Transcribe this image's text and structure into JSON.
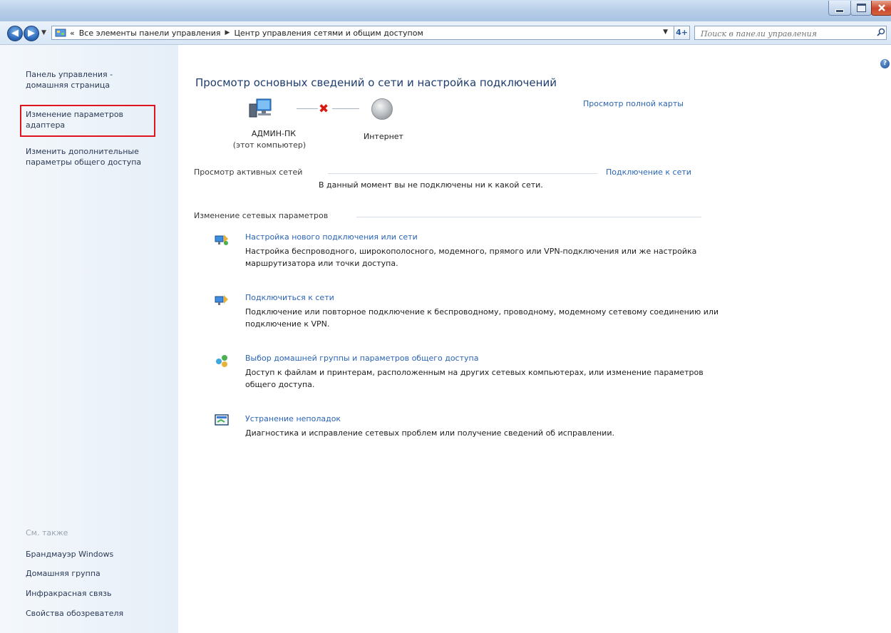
{
  "window": {
    "colors": {
      "title_gradient": "#b6cde8",
      "link": "#2a64b5",
      "highlight_box": "#e0141e",
      "close_button": "#c8462a"
    }
  },
  "address": {
    "overflow": "«",
    "crumbs": [
      "Все элементы панели управления",
      "Центр управления сетями и общим доступом"
    ],
    "search_placeholder": "Поиск в панели управления",
    "refresh_glyph": "4+"
  },
  "icons": {
    "back": "back-arrow-icon",
    "forward": "forward-arrow-icon",
    "control_panel": "control-panel-icon",
    "search": "search-icon",
    "help": "help-icon",
    "computer": "computer-icon",
    "globe": "globe-icon",
    "disconnect": "red-x-icon"
  },
  "sidebar": {
    "home": "Панель управления - домашняя страница",
    "adapter": "Изменение параметров адаптера",
    "sharing": "Изменить дополнительные параметры общего доступа",
    "see_also_label": "См. также",
    "see_also": [
      "Брандмауэр Windows",
      "Домашняя группа",
      "Инфракрасная связь",
      "Свойства обозревателя"
    ]
  },
  "main": {
    "title": "Просмотр основных сведений о сети и настройка подключений",
    "full_map": "Просмотр полной карты",
    "computer_name": "АДМИН-ПК",
    "computer_sub": "(этот компьютер)",
    "internet": "Интернет",
    "active_title": "Просмотр активных сетей",
    "connect_link": "Подключение к сети",
    "no_network": "В данный момент вы не подключены ни к какой сети.",
    "change_title": "Изменение сетевых параметров",
    "tasks": [
      {
        "link": "Настройка нового подключения или сети",
        "desc": "Настройка беспроводного, широкополосного, модемного, прямого или VPN-подключения или же настройка маршрутизатора или точки доступа."
      },
      {
        "link": "Подключиться к сети",
        "desc": "Подключение или повторное подключение к беспроводному, проводному, модемному сетевому соединению или подключение к VPN."
      },
      {
        "link": "Выбор домашней группы и параметров общего доступа",
        "desc": "Доступ к файлам и принтерам, расположенным на других сетевых компьютерах, или изменение параметров общего доступа."
      },
      {
        "link": "Устранение неполадок",
        "desc": "Диагностика и исправление сетевых проблем или получение сведений об исправлении."
      }
    ]
  }
}
